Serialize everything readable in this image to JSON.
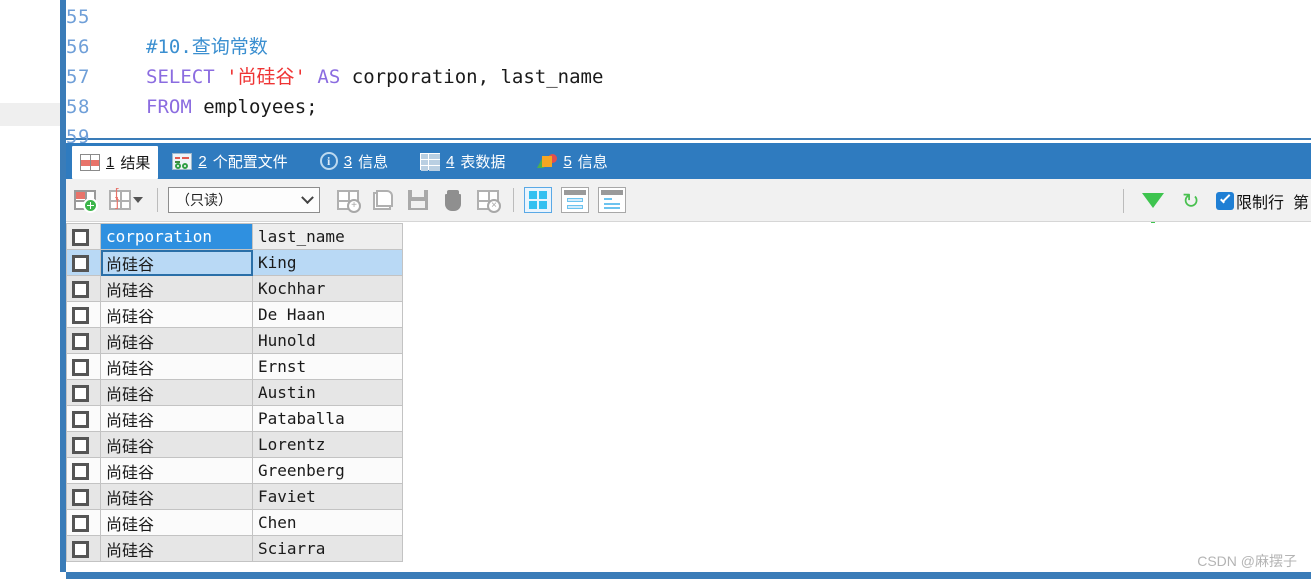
{
  "editor": {
    "lines": [
      {
        "no": "55",
        "segments": []
      },
      {
        "no": "56",
        "segments": [
          {
            "t": "#10.查询常数",
            "c": "cmt"
          }
        ]
      },
      {
        "no": "57",
        "segments": [
          {
            "t": "SELECT ",
            "c": "kw"
          },
          {
            "t": "'尚硅谷'",
            "c": "str"
          },
          {
            "t": " ",
            "c": "plain"
          },
          {
            "t": "AS",
            "c": "kw"
          },
          {
            "t": " corporation, last_name",
            "c": "plain"
          }
        ]
      },
      {
        "no": "58",
        "segments": [
          {
            "t": "FROM",
            "c": "kw"
          },
          {
            "t": " employees;",
            "c": "plain"
          }
        ]
      },
      {
        "no": "59",
        "segments": []
      }
    ]
  },
  "tabs": [
    {
      "num": "1",
      "label": "结果",
      "icon": "results-grid-icon",
      "active": true
    },
    {
      "num": "2",
      "label": "个配置文件",
      "icon": "profile-icon",
      "active": false
    },
    {
      "num": "3",
      "label": "信息",
      "icon": "info-circle-icon",
      "active": false
    },
    {
      "num": "4",
      "label": "表数据",
      "icon": "table-data-icon",
      "active": false
    },
    {
      "num": "5",
      "label": "信息",
      "icon": "pie-chart-icon",
      "active": false
    }
  ],
  "toolbar": {
    "mode_select_value": "（只读）",
    "limit_rows_label": "限制行",
    "limit_rows_checked": true,
    "limit_rows_cut_text": "第",
    "buttons": {
      "insert_row": "插入行",
      "edit_cell": "编辑单元格",
      "apply_changes": "应用更改",
      "revert": "撤销",
      "save_changes": "保存更改",
      "delete_row": "删除行",
      "cancel_changes": "取消更改",
      "view_grid": "网格视图",
      "view_form": "表单视图",
      "view_field": "字段视图",
      "filter": "筛选",
      "refresh": "刷新"
    }
  },
  "grid": {
    "columns": [
      "corporation",
      "last_name"
    ],
    "selected_column": "corporation",
    "selected_row_index": 0,
    "rows": [
      [
        "尚硅谷",
        "King"
      ],
      [
        "尚硅谷",
        "Kochhar"
      ],
      [
        "尚硅谷",
        "De Haan"
      ],
      [
        "尚硅谷",
        "Hunold"
      ],
      [
        "尚硅谷",
        "Ernst"
      ],
      [
        "尚硅谷",
        "Austin"
      ],
      [
        "尚硅谷",
        "Pataballa"
      ],
      [
        "尚硅谷",
        "Lorentz"
      ],
      [
        "尚硅谷",
        "Greenberg"
      ],
      [
        "尚硅谷",
        "Faviet"
      ],
      [
        "尚硅谷",
        "Chen"
      ],
      [
        "尚硅谷",
        "Sciarra"
      ]
    ]
  },
  "watermark": "CSDN @麻摆子",
  "colors": {
    "tabbar_blue": "#2f7bbf",
    "rail_blue": "#3a7cb8",
    "header_selected": "#2f90e0",
    "row_selected": "#b9d9f5",
    "string_red": "#ef3434",
    "keyword_purple": "#8b6ce0",
    "comment_blue": "#3b8fd0"
  }
}
